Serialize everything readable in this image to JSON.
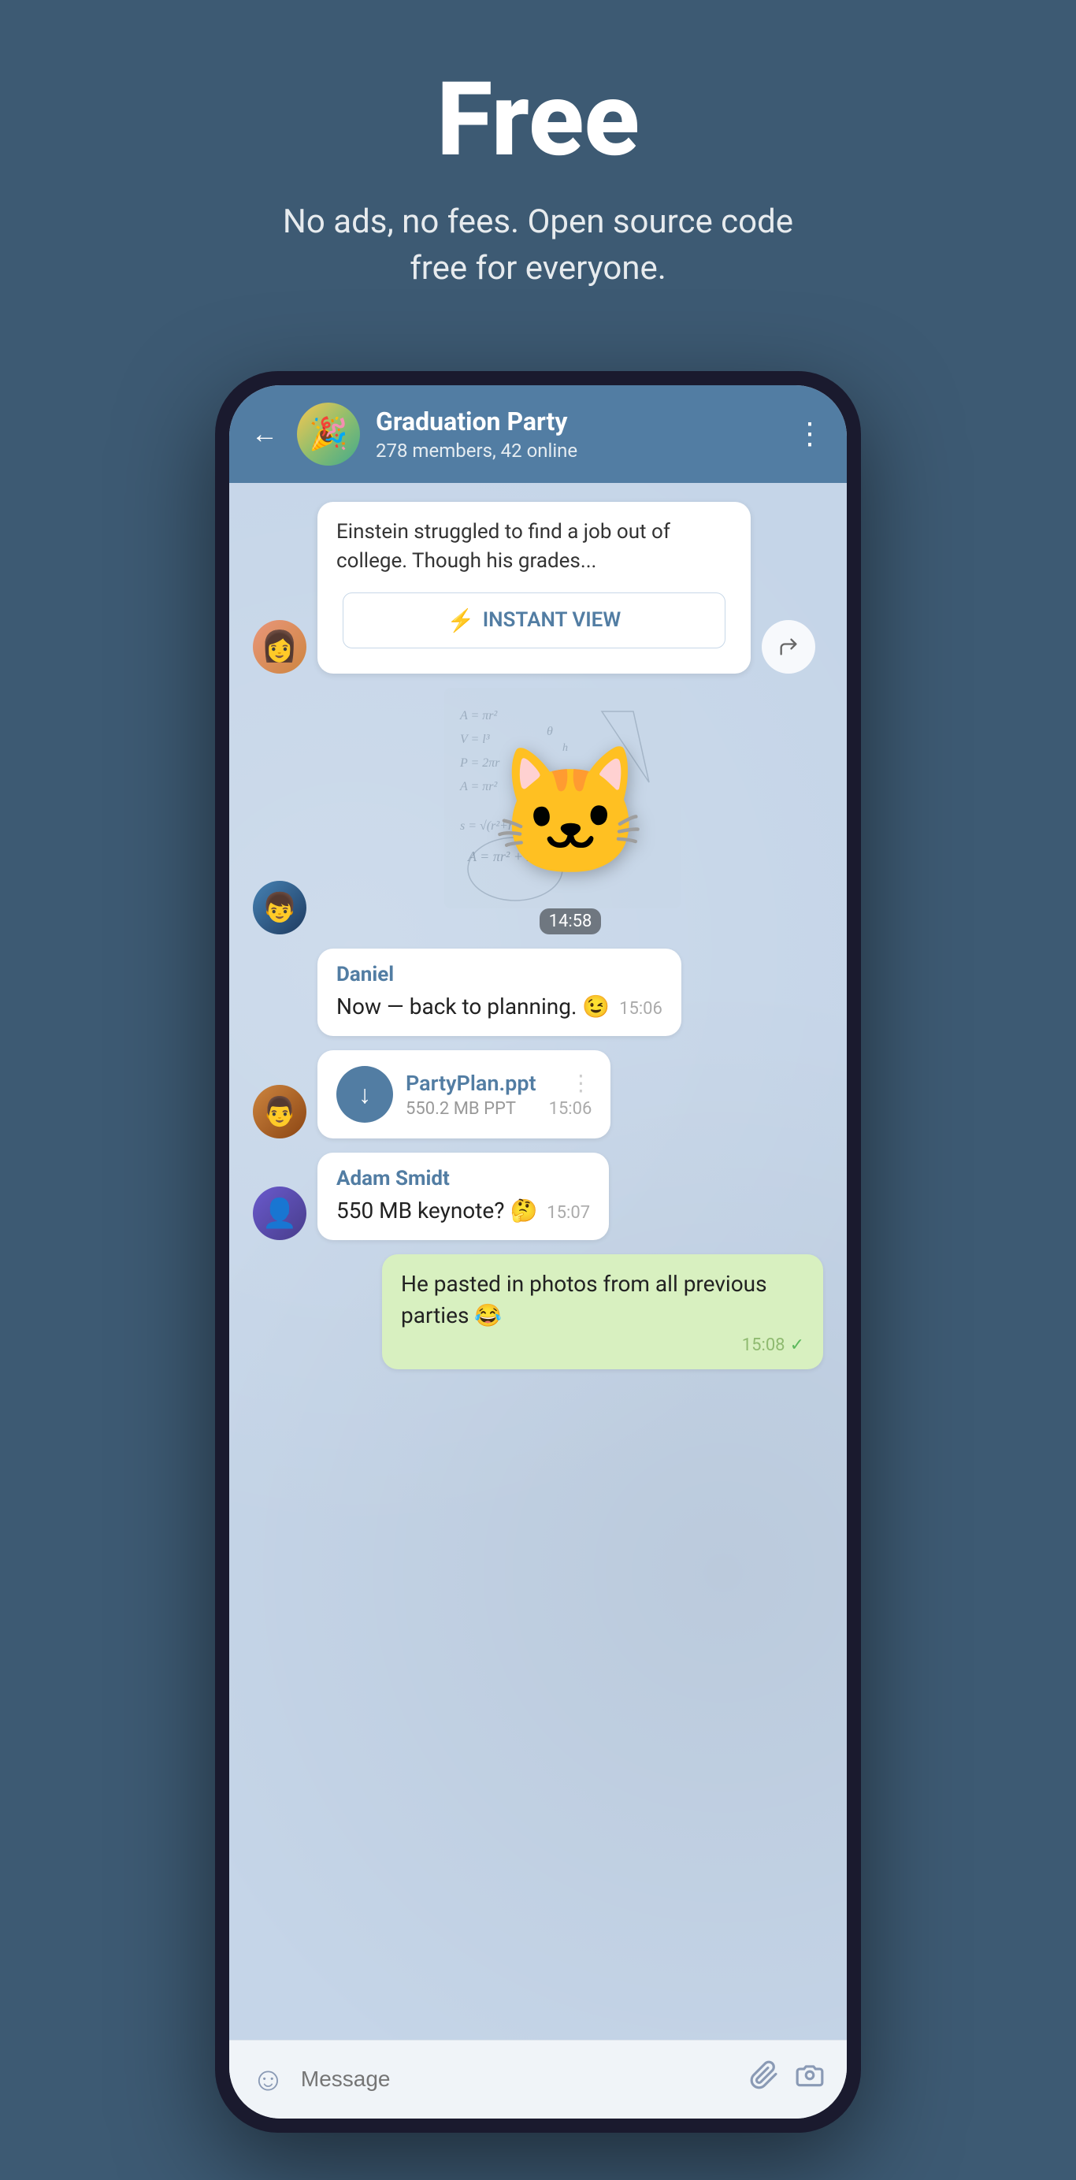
{
  "hero": {
    "title": "Free",
    "subtitle": "No ads, no fees. Open source code free for everyone."
  },
  "chat": {
    "back_label": "←",
    "group_name": "Graduation Party",
    "group_status": "278 members, 42 online",
    "more_icon": "⋮",
    "link_preview_text": "Einstein struggled to find a job out of college. Though his grades...",
    "instant_view_label": "INSTANT VIEW",
    "sticker_time": "14:58",
    "messages": [
      {
        "sender": "Daniel",
        "text": "Now — back to planning. 😉",
        "time": "15:06",
        "type": "text"
      },
      {
        "sender": null,
        "file_name": "PartyPlan.ppt",
        "file_size": "550.2 MB PPT",
        "time": "15:06",
        "type": "file"
      },
      {
        "sender": "Adam Smidt",
        "text": "550 MB keynote? 🤔",
        "time": "15:07",
        "type": "text"
      },
      {
        "sender": "own",
        "text": "He pasted in photos from all previous parties 😂",
        "time": "15:08",
        "type": "own"
      }
    ],
    "input_placeholder": "Message",
    "emoji_icon": "☺",
    "attach_icon": "📎",
    "camera_icon": "⊙"
  }
}
